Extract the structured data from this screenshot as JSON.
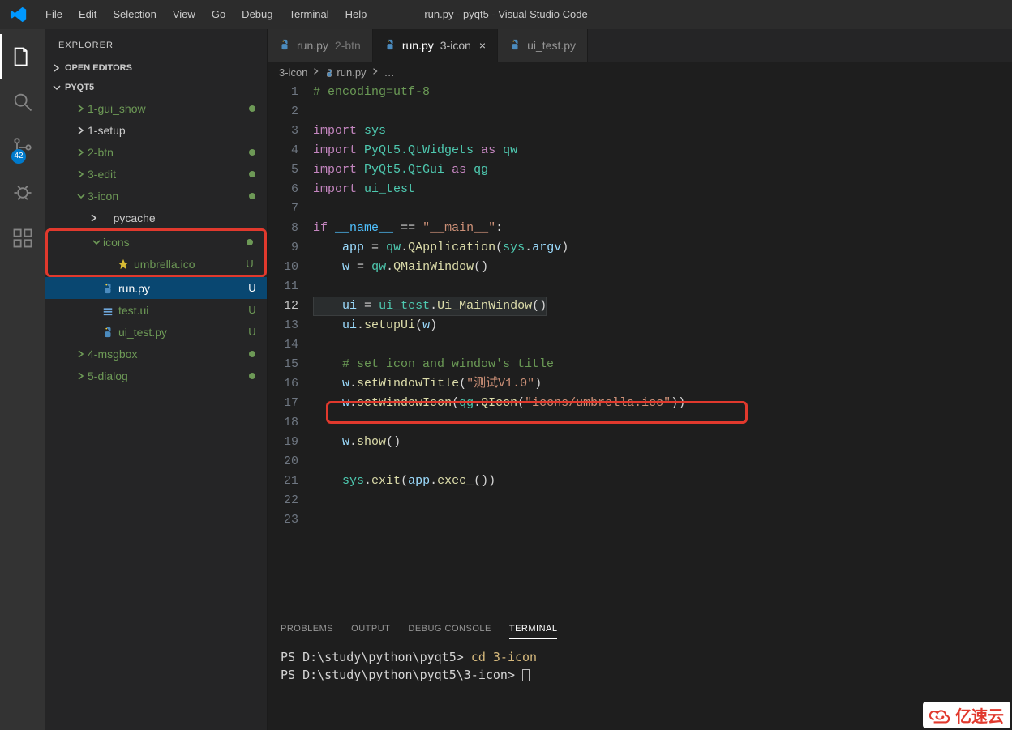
{
  "title": "run.py - pyqt5 - Visual Studio Code",
  "menu": [
    "File",
    "Edit",
    "Selection",
    "View",
    "Go",
    "Debug",
    "Terminal",
    "Help"
  ],
  "activity_badge": "42",
  "explorer": {
    "header": "EXPLORER",
    "open_editors": "OPEN EDITORS",
    "root": "PYQT5",
    "items": [
      {
        "label": "1-gui_show",
        "kind": "folder-c",
        "depth": 2,
        "green": true,
        "dot": true
      },
      {
        "label": "1-setup",
        "kind": "folder-c",
        "depth": 2
      },
      {
        "label": "2-btn",
        "kind": "folder-c",
        "depth": 2,
        "green": true,
        "dot": true
      },
      {
        "label": "3-edit",
        "kind": "folder-c",
        "depth": 2,
        "green": true,
        "dot": true
      },
      {
        "label": "3-icon",
        "kind": "folder-o",
        "depth": 2,
        "green": true,
        "dot": true
      },
      {
        "label": "__pycache__",
        "kind": "folder-c",
        "depth": 3
      },
      {
        "label": "icons",
        "kind": "folder-o",
        "depth": 3,
        "green": true,
        "dot": true,
        "box": "top"
      },
      {
        "label": "umbrella.ico",
        "kind": "star",
        "depth": 4,
        "green": true,
        "u": true,
        "box": "bot"
      },
      {
        "label": "run.py",
        "kind": "py",
        "depth": 3,
        "sel": true,
        "u": true
      },
      {
        "label": "test.ui",
        "kind": "ui",
        "depth": 3,
        "green": true,
        "u": true
      },
      {
        "label": "ui_test.py",
        "kind": "py",
        "depth": 3,
        "green": true,
        "u": true
      },
      {
        "label": "4-msgbox",
        "kind": "folder-c",
        "depth": 2,
        "green": true,
        "dot": true
      },
      {
        "label": "5-dialog",
        "kind": "folder-c",
        "depth": 2,
        "green": true,
        "dot": true
      }
    ]
  },
  "tabs": [
    {
      "name": "run.py",
      "sub": "2-btn",
      "icon": "py"
    },
    {
      "name": "run.py",
      "sub": "3-icon",
      "icon": "py",
      "active": true,
      "close": true
    },
    {
      "name": "ui_test.py",
      "sub": "",
      "icon": "py"
    }
  ],
  "breadcrumb": [
    "3-icon",
    "run.py",
    "…"
  ],
  "code_lines": [
    "<span class='c-cmt'># encoding=utf-8</span>",
    "",
    "<span class='c-kw'>import</span> <span class='c-mod'>sys</span>",
    "<span class='c-kw'>import</span> <span class='c-mod'>PyQt5.QtWidgets</span> <span class='c-kw'>as</span> <span class='c-mod'>qw</span>",
    "<span class='c-kw'>import</span> <span class='c-mod'>PyQt5.QtGui</span> <span class='c-kw'>as</span> <span class='c-mod'>qg</span>",
    "<span class='c-kw'>import</span> <span class='c-mod'>ui_test</span>",
    "",
    "<span class='c-kw'>if</span> <span class='c-var'>__name__</span> <span class='c-op'>==</span> <span class='c-str'>\"__main__\"</span><span class='c-op'>:</span>",
    "    <span class='c-prm'>app</span> <span class='c-op'>=</span> <span class='c-mod'>qw</span><span class='c-op'>.</span><span class='c-fn'>QApplication</span><span class='c-op'>(</span><span class='c-mod'>sys</span><span class='c-op'>.</span><span class='c-prm'>argv</span><span class='c-op'>)</span>",
    "    <span class='c-prm'>w</span> <span class='c-op'>=</span> <span class='c-mod'>qw</span><span class='c-op'>.</span><span class='c-fn'>QMainWindow</span><span class='c-op'>()</span>",
    "",
    "    <span class='c-prm'>ui</span> <span class='c-op'>=</span> <span class='c-mod'>ui_test</span><span class='c-op'>.</span><span class='c-fn'>Ui_MainWindow</span><span class='c-op'>()</span>",
    "    <span class='c-prm'>ui</span><span class='c-op'>.</span><span class='c-fn'>setupUi</span><span class='c-op'>(</span><span class='c-prm'>w</span><span class='c-op'>)</span>",
    "",
    "    <span class='c-cmt'># set icon and window's title</span>",
    "    <span class='c-prm'>w</span><span class='c-op'>.</span><span class='c-fn'>setWindowTitle</span><span class='c-op'>(</span><span class='c-str'>\"测试V1.0\"</span><span class='c-op'>)</span>",
    "    <span class='c-prm'>w</span><span class='c-op'>.</span><span class='c-fn'>setWindowIcon</span><span class='c-op'>(</span><span class='c-mod'>qg</span><span class='c-op'>.</span><span class='c-fn'>QIcon</span><span class='c-op'>(</span><span class='c-str'>\"icons/umbrella.ico\"</span><span class='c-op'>))</span>",
    "",
    "    <span class='c-prm'>w</span><span class='c-op'>.</span><span class='c-fn'>show</span><span class='c-op'>()</span>",
    "",
    "    <span class='c-mod'>sys</span><span class='c-op'>.</span><span class='c-fn'>exit</span><span class='c-op'>(</span><span class='c-prm'>app</span><span class='c-op'>.</span><span class='c-fn'>exec_</span><span class='c-op'>())</span>",
    "",
    ""
  ],
  "active_line": 12,
  "panel": {
    "tabs": [
      "PROBLEMS",
      "OUTPUT",
      "DEBUG CONSOLE",
      "TERMINAL"
    ],
    "active": 3,
    "lines": [
      {
        "prompt": "PS D:\\study\\python\\pyqt5> ",
        "cmd": "cd 3-icon"
      },
      {
        "prompt": "PS D:\\study\\python\\pyqt5\\3-icon> ",
        "cmd": ""
      }
    ]
  },
  "watermark": "亿速云"
}
